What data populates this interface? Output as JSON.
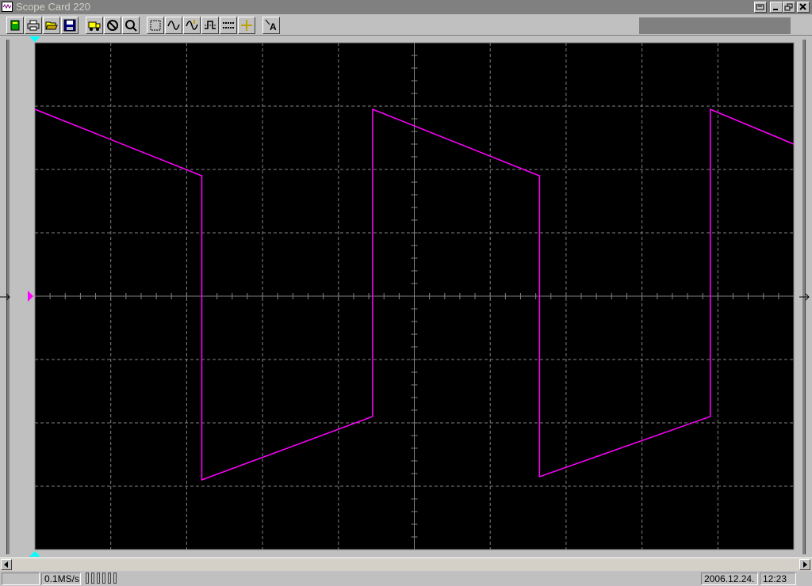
{
  "window": {
    "title": "Scope Card 220",
    "buttons": [
      "restore-tile-icon",
      "minimize-icon",
      "restore-icon",
      "close-icon"
    ]
  },
  "toolbar": {
    "buttons": [
      {
        "name": "new-button",
        "icon": "book-icon"
      },
      {
        "name": "print-button",
        "icon": "printer-icon"
      },
      {
        "name": "open-button",
        "icon": "folder-open-icon"
      },
      {
        "name": "save-button",
        "icon": "floppy-icon"
      },
      {
        "name": "run-button",
        "icon": "truck-icon"
      },
      {
        "name": "stop-button",
        "icon": "stop-icon"
      },
      {
        "name": "zoom-button",
        "icon": "magnifier-icon"
      },
      {
        "name": "grid-button",
        "icon": "grid-icon"
      },
      {
        "name": "waveform-button",
        "icon": "sine-wave-icon"
      },
      {
        "name": "waveform-2-button",
        "icon": "sine-wave-marker-icon"
      },
      {
        "name": "trigger-button",
        "icon": "trigger-icon"
      },
      {
        "name": "cursor-lines-button",
        "icon": "dashed-lines-icon"
      },
      {
        "name": "crosshair-button",
        "icon": "crosshair-icon"
      },
      {
        "name": "text-button",
        "icon": "text-cursor-icon"
      }
    ]
  },
  "colors": {
    "screen": "#000000",
    "grid": "#808080",
    "trace": "#ff00ff",
    "trigger_marker": "#00ffff",
    "ground_marker": "#ff00ff"
  },
  "scope": {
    "divisions_x": 10,
    "divisions_y": 8,
    "chart_data": {
      "type": "line",
      "x_range": [
        -5,
        5
      ],
      "y_range": [
        -4,
        4
      ],
      "series": [
        {
          "x": [
            -5.0,
            -2.8,
            -2.8,
            -0.55,
            -0.55,
            1.65,
            1.65,
            3.9,
            3.9,
            5.0
          ],
          "y": [
            2.95,
            1.9,
            -2.9,
            -1.9,
            2.95,
            1.9,
            -2.85,
            -1.9,
            2.95,
            2.4
          ]
        }
      ]
    }
  },
  "status": {
    "sample_rate": "0.1MS/s",
    "date": "2006.12.24.",
    "time": "12:23"
  }
}
